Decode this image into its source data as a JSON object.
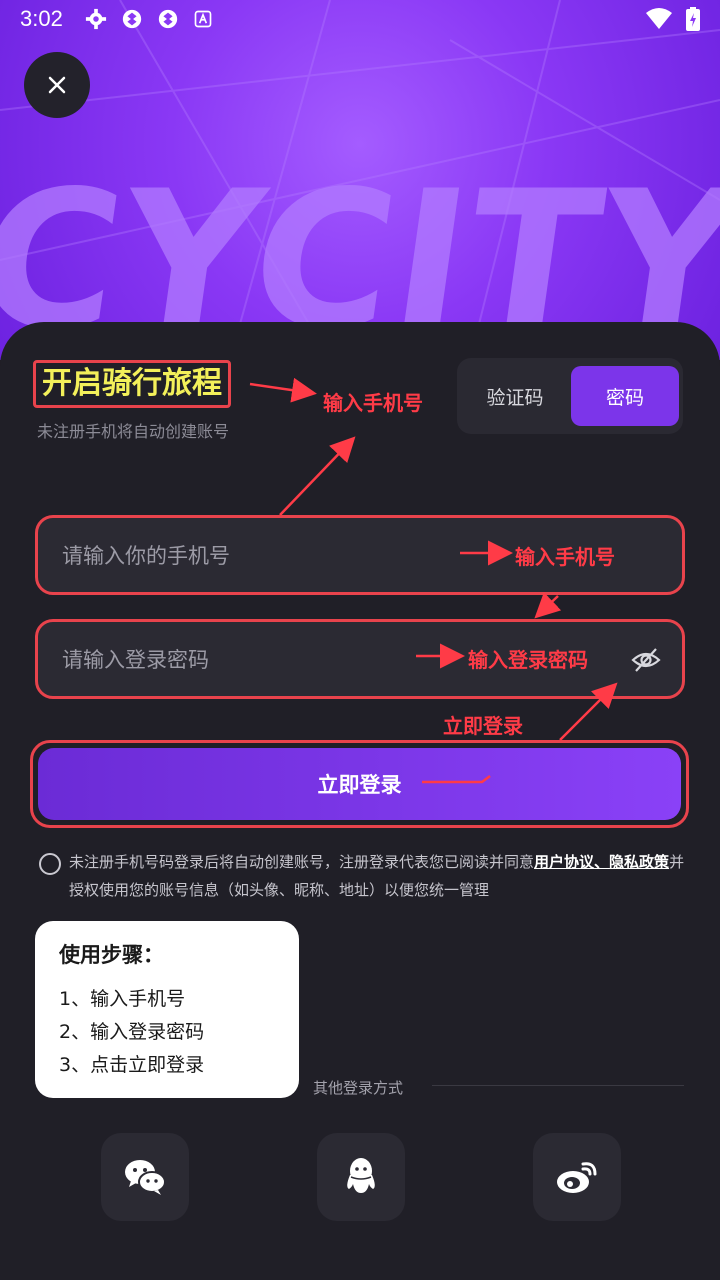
{
  "status": {
    "time": "3:02"
  },
  "hero": {
    "brand_text": "CYCITY"
  },
  "header": {
    "title": "开启骑行旅程",
    "subtitle": "未注册手机将自动创建账号"
  },
  "tabs": [
    {
      "label": "验证码",
      "active": false
    },
    {
      "label": "密码",
      "active": true
    }
  ],
  "form": {
    "phone_placeholder": "请输入你的手机号",
    "password_placeholder": "请输入登录密码",
    "login_label": "立即登录"
  },
  "annotations": {
    "top": "输入手机号",
    "phone": "输入手机号",
    "password": "输入登录密码",
    "login": "立即登录"
  },
  "agreement": {
    "text_before": "未注册手机号码登录后将自动创建账号，注册登录代表您已阅读并同意",
    "link1": "用户协议",
    "sep": "、",
    "link2": "隐私政策",
    "text_after": "并授权使用您的账号信息（如头像、昵称、地址）以便您统一管理"
  },
  "steps": {
    "heading": "使用步骤：",
    "items": [
      "1、输入手机号",
      "2、输入登录密码",
      "3、点击立即登录"
    ]
  },
  "other_login": {
    "label": "其他登录方式",
    "options": [
      "wechat-icon",
      "qq-icon",
      "weibo-icon"
    ]
  },
  "colors": {
    "accent": "#7c35ea",
    "annotation": "#e8434c",
    "highlight": "#f3f05a"
  }
}
